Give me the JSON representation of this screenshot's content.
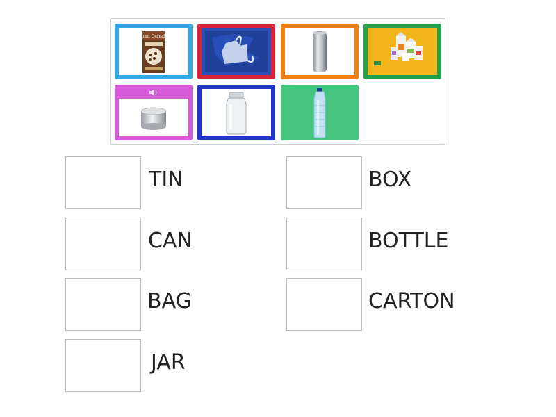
{
  "cards": [
    {
      "name": "cereal-box-card",
      "color": "#34a7e6",
      "icon": "cereal-box-icon",
      "box_text": "Gran Cereale"
    },
    {
      "name": "plastic-bag-card",
      "color": "#d8233a",
      "icon": "plastic-bag-icon"
    },
    {
      "name": "drink-can-card",
      "color": "#f07f14",
      "icon": "drink-can-icon"
    },
    {
      "name": "cartons-card",
      "color": "#23a24d",
      "icon": "cartons-icon"
    },
    {
      "name": "tin-card",
      "color": "#d45ad8",
      "icon": "tin-icon",
      "has_audio": true
    },
    {
      "name": "glass-jar-card",
      "color": "#2234c9",
      "icon": "jar-icon"
    },
    {
      "name": "water-bottle-card",
      "color": "#44c47f",
      "icon": "bottle-icon"
    }
  ],
  "targets": [
    {
      "label": "TIN"
    },
    {
      "label": "BOX"
    },
    {
      "label": "CAN"
    },
    {
      "label": "BOTTLE"
    },
    {
      "label": "BAG"
    },
    {
      "label": "CARTON"
    },
    {
      "label": "JAR"
    }
  ]
}
